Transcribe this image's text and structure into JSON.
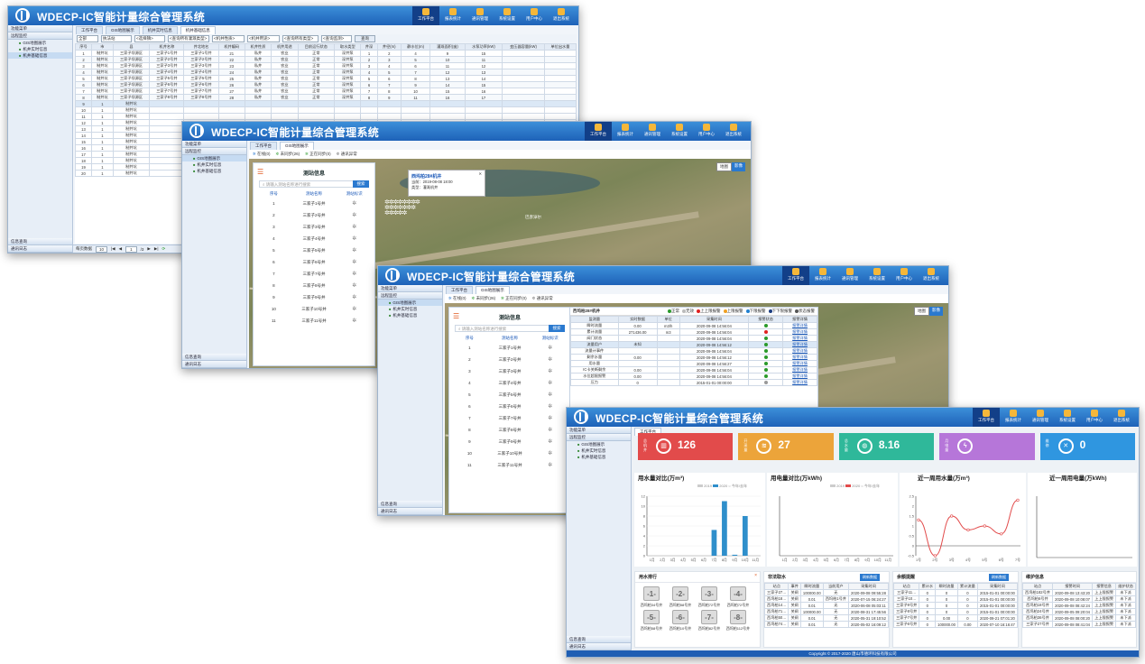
{
  "app": {
    "title": "WDECP-IC智能计量综合管理系统"
  },
  "nav": [
    "工作平台",
    "报表统计",
    "通讯管理",
    "系统设置",
    "用户中心",
    "退出系统"
  ],
  "sidebar": {
    "header": "功能菜单",
    "group": "远程监控",
    "items": [
      "GIS地图展示",
      "机井实时信息",
      "机井基础信息"
    ],
    "bottom": [
      "信息查询",
      "通讯日志"
    ]
  },
  "win1": {
    "tabs": [
      "工作平台",
      "GIS地图展示",
      "机井实时信息",
      "机井基础信息"
    ],
    "filter": {
      "range": "全部",
      "sel1": "执法站",
      "sel2": "<选择镇>",
      "sel3": "<查询所有灌溉类型>",
      "sel4": "<机井性质>",
      "sel5": "<机井用途>",
      "sel6": "<查询所有类型>",
      "sel7": "<查询监测>",
      "btn": "查询"
    },
    "columns": [
      "序号",
      "市",
      "县",
      "机井名称",
      "井北地名",
      "机井编码",
      "机井性质",
      "机井用途",
      "目前运行状态",
      "取水类型",
      "井深",
      "井径(m)",
      "静水位(m)",
      "灌溉面积(亩)",
      "水泵功率(kW)",
      "变压器容量(kW)",
      "单位出水量"
    ],
    "rows": [
      [
        "1",
        "制井坑",
        "三家子坝源区",
        "三家子1号井",
        "三家子1号井",
        "21",
        "私井",
        "农业",
        "正常",
        "深井泵",
        "1",
        "2",
        "4",
        "9",
        "15"
      ],
      [
        "2",
        "制井坑",
        "三家子坝源区",
        "三家子2号井",
        "三家子2号井",
        "22",
        "私井",
        "农业",
        "正常",
        "深井泵",
        "2",
        "3",
        "5",
        "10",
        "11"
      ],
      [
        "3",
        "制井坑",
        "三家子坝源区",
        "三家子3号井",
        "三家子3号井",
        "23",
        "私井",
        "农业",
        "正常",
        "深井泵",
        "3",
        "4",
        "6",
        "11",
        "12"
      ],
      [
        "4",
        "制井坑",
        "三家子坝源区",
        "三家子4号井",
        "三家子4号井",
        "24",
        "私井",
        "农业",
        "正常",
        "深井泵",
        "4",
        "5",
        "7",
        "12",
        "13"
      ],
      [
        "5",
        "制井坑",
        "三家子坝源区",
        "三家子5号井",
        "三家子5号井",
        "25",
        "私井",
        "农业",
        "正常",
        "深井泵",
        "5",
        "6",
        "8",
        "13",
        "14"
      ],
      [
        "6",
        "制井坑",
        "三家子坝源区",
        "三家子6号井",
        "三家子6号井",
        "26",
        "私井",
        "农业",
        "正常",
        "深井泵",
        "6",
        "7",
        "9",
        "14",
        "15"
      ],
      [
        "7",
        "制井坑",
        "三家子坝源区",
        "三家子7号井",
        "三家子7号井",
        "27",
        "私井",
        "农业",
        "正常",
        "深井泵",
        "7",
        "8",
        "10",
        "15",
        "16"
      ],
      [
        "8",
        "制井坑",
        "三家子坝源区",
        "三家子8号井",
        "三家子8号井",
        "28",
        "私井",
        "农业",
        "正常",
        "深井泵",
        "8",
        "9",
        "11",
        "16",
        "17"
      ]
    ],
    "rownums": [
      "9",
      "10",
      "11",
      "12",
      "13",
      "14",
      "15",
      "16",
      "17",
      "18",
      "19",
      "20"
    ],
    "pager": {
      "size": "每页数据",
      "num": "10",
      "page": "1",
      "of": "/3"
    }
  },
  "win2": {
    "tabs": [
      "工作平台",
      "GIS地图展示"
    ],
    "legend": [
      "在线(0)",
      "未同步(26)",
      "正在同步(0)",
      "通讯异常"
    ],
    "panel_title": "测站信息",
    "search_ph": "请输入测站名称进行搜索",
    "search_btn": "搜索",
    "cols": [
      "序号",
      "测站名称",
      "测站标识"
    ],
    "stations": [
      "三家子1号井",
      "三家子2号井",
      "三家子3号井",
      "三家子4号井",
      "三家子5号井",
      "三家子6号井",
      "三家子7号井",
      "三家子8号井",
      "三家子9号井",
      "三家子10号井",
      "三家子11号井"
    ],
    "popup": {
      "title": "西坞柏28#机井",
      "line1": "当前：",
      "line2": "类型：",
      "val1": "2019-08-08 18:00",
      "val2": "灌溉机井"
    },
    "mapbtns": [
      "地图",
      "影像"
    ],
    "place": "巴彦淖尔"
  },
  "win3": {
    "tabs": [
      "工作平台",
      "GIS地图展示"
    ],
    "legend": [
      "在线(0)",
      "未同步(26)",
      "正在同步(0)",
      "通讯异常"
    ],
    "panel_title": "测站信息",
    "stations": [
      "三家子1号井",
      "三家子2号井",
      "三家子3号井",
      "三家子4号井",
      "三家子5号井",
      "三家子6号井",
      "三家子7号井",
      "三家子8号井",
      "三家子9号井",
      "三家子10号井",
      "三家子11号井"
    ],
    "detail_title": "西坞柏28#机井",
    "status_legend": [
      "正常",
      "无效",
      "上上限报警",
      "上限报警",
      "下限报警",
      "下下限报警",
      "状态报警"
    ],
    "detail_cols": [
      "监测量",
      "实时数据",
      "单位",
      "采集时间",
      "报警状态",
      "报警详情"
    ],
    "detail_rows": [
      [
        "瞬时流量",
        "0.00",
        "m3/h",
        "2020-09-08 14:56:04",
        "green",
        "报警详情"
      ],
      [
        "累计流量",
        "271436.00",
        "m3",
        "2020-09-08 14:56:04",
        "red",
        "报警详情"
      ],
      [
        "阀门状态",
        "",
        "",
        "2020-09-08 14:56:04",
        "green",
        "报警详情"
      ],
      [
        "流量用户",
        "未知",
        "",
        "2020-09-08 14:56:12",
        "green",
        "报警详情"
      ],
      [
        "流量计事件",
        "",
        "",
        "2020-09-08 14:56:04",
        "green",
        "报警详情"
      ],
      [
        "剩余水量",
        "0.00",
        "",
        "2020-09-08 14:56:12",
        "green",
        "报警详情"
      ],
      [
        "用水量",
        "",
        "",
        "2020-09-08 14:56:27",
        "green",
        "报警详情"
      ],
      [
        "IC卡关断剩余",
        "0.00",
        "",
        "2020-09-08 14:56:04",
        "green",
        "报警详情"
      ],
      [
        "水位超限报警",
        "0.00",
        "",
        "2020-09-08 14:56:04",
        "green",
        "报警详情"
      ],
      [
        "压力",
        "0",
        "",
        "2015-01-01 00:00:00",
        "gray",
        "报警详情"
      ]
    ]
  },
  "win4": {
    "cards": [
      {
        "label": "总机井",
        "value": "126",
        "color": "#e24b4b"
      },
      {
        "label": "开采量",
        "value": "27",
        "color": "#eca43a"
      },
      {
        "label": "总水量",
        "value": "8.16",
        "color": "#2fb89a"
      },
      {
        "label": "月电量",
        "value": "",
        "color": "#b676d9"
      },
      {
        "label": "维修",
        "value": "0",
        "color": "#2f96e0"
      }
    ],
    "charts": [
      {
        "title": "用水量对比(万m³)",
        "legend": [
          "2019",
          "2020",
          "今年/去年"
        ]
      },
      {
        "title": "用电量对比(万kWh)",
        "legend": [
          "2019",
          "2020",
          "今年/去年"
        ]
      },
      {
        "title": "近一周用水量(万m³)"
      },
      {
        "title": "近一周用电量(万kWh)"
      }
    ],
    "rank": {
      "title": "用水排行",
      "items": [
        {
          "rank": "-1-",
          "name": "西坞柏34号井"
        },
        {
          "rank": "-2-",
          "name": "西坞柏58号井"
        },
        {
          "rank": "-3-",
          "name": "西坞柏72号井"
        },
        {
          "rank": "-4-",
          "name": "西坞柏72号井"
        },
        {
          "rank": "-5-",
          "name": "西坞柏58号井"
        },
        {
          "rank": "-6-",
          "name": "西坞柏10号井"
        },
        {
          "rank": "-7-",
          "name": "西坞柏82号井"
        },
        {
          "rank": "-8-",
          "name": "西坞柏112号井"
        }
      ]
    },
    "illegal": {
      "title": "非法取水",
      "btn": "刷新数据",
      "cols": [
        "站点",
        "事件",
        "瞬时流量",
        "当前用户",
        "采集时间"
      ],
      "rows": [
        [
          "三家子27…",
          "关闸",
          "100000.00",
          "无",
          "2020-09-08 09:55:28"
        ],
        [
          "西坞柏18…",
          "关闸",
          "0.01",
          "西坞柏1号井",
          "2020-07-15 06:24:27"
        ],
        [
          "西坞柏14…",
          "关闸",
          "0.01",
          "无",
          "2020-06-08 05:03:11"
        ],
        [
          "西坞柏71…",
          "关闸",
          "100000.00",
          "无",
          "2020-08-31 17:45:56"
        ],
        [
          "西坞柏50…",
          "关闸",
          "0.01",
          "无",
          "2020-05-31 19:10:52"
        ],
        [
          "西坞柏74…",
          "关闸",
          "0.01",
          "无",
          "2020-05-02 16:09:12"
        ]
      ]
    },
    "pressure": {
      "title": "余额提醒",
      "btn": "刷新数据",
      "cols": [
        "站点",
        "累计水",
        "瞬时流量",
        "累计流量",
        "采集时间"
      ],
      "rows": [
        [
          "三家子11…",
          "0",
          "0",
          "0",
          "2015-01-01 00:00:00"
        ],
        [
          "三家子10…",
          "0",
          "0",
          "0",
          "2015-01-01 00:00:00"
        ],
        [
          "三家子9号井",
          "0",
          "0",
          "0",
          "2015-01-01 00:00:00"
        ],
        [
          "三家子8号井",
          "0",
          "0",
          "0",
          "2015-01-01 00:00:00"
        ],
        [
          "三家子7号井",
          "0",
          "0.00",
          "0",
          "2020-09-21 07:01:20"
        ],
        [
          "三家子6号井",
          "0",
          "100000.00",
          "0.00",
          "2020-07-10 16:16:47"
        ]
      ]
    },
    "maint": {
      "title": "维护信息",
      "cols": [
        "站点",
        "报警时间",
        "报警信息",
        "维护状态"
      ],
      "rows": [
        [
          "西坞柏182号井",
          "2020-09-08 13:43:20",
          "上上限报警",
          "未下派"
        ],
        [
          "西坞柏6号井",
          "2020-09-08 10:08:07",
          "上上限报警",
          "未下派"
        ],
        [
          "西坞柏18号井",
          "2020-09-08 08:42:24",
          "上上限报警",
          "未下派"
        ],
        [
          "西坞柏24号井",
          "2020-09-05 09:20:04",
          "上上限报警",
          "未下派"
        ],
        [
          "西坞柏36号井",
          "2020-09-08 08:00:20",
          "上上限报警",
          "未下派"
        ],
        [
          "三家子27号井",
          "2020-09-08 08:41:04",
          "上上限报警",
          "未下派"
        ]
      ]
    },
    "copyright": "Copyright © 2017-2020 唐山市德环科技有限公司"
  },
  "chart_data": [
    {
      "type": "bar",
      "title": "用水量对比(万m³)",
      "categories": [
        "1月",
        "2月",
        "3月",
        "4月",
        "5月",
        "6月",
        "7月",
        "8月",
        "9月",
        "10月",
        "11月"
      ],
      "series": [
        {
          "name": "2019",
          "values": [
            0,
            0,
            0,
            0,
            0,
            0,
            0,
            0,
            0,
            0,
            0
          ]
        },
        {
          "name": "2020",
          "values": [
            0,
            0,
            0,
            0,
            0,
            0,
            5.2,
            11,
            0.2,
            8,
            0
          ]
        }
      ],
      "ylim": [
        0,
        12
      ]
    },
    {
      "type": "bar",
      "title": "用电量对比(万kWh)",
      "categories": [
        "1月",
        "2月",
        "3月",
        "4月",
        "5月",
        "6月",
        "7月",
        "8月",
        "9月",
        "10月",
        "11月"
      ],
      "series": [
        {
          "name": "2019",
          "values": [
            0,
            0,
            0,
            0,
            0,
            0,
            0,
            0,
            0,
            0,
            0
          ]
        },
        {
          "name": "2020",
          "values": [
            0,
            0,
            0,
            0,
            0,
            0,
            0,
            0,
            0,
            0,
            0
          ]
        }
      ]
    },
    {
      "type": "line",
      "title": "近一周用水量(万m³)",
      "categories": [
        "1号",
        "2号",
        "3号",
        "4号",
        "5号",
        "6号",
        "7号"
      ],
      "series": [
        {
          "name": "",
          "values": [
            1.3,
            -0.5,
            1.5,
            0.8,
            1.0,
            0.6,
            2.3
          ]
        }
      ],
      "ylim": [
        -0.5,
        2.5
      ]
    },
    {
      "type": "line",
      "title": "近一周用电量(万kWh)",
      "categories": [],
      "series": []
    }
  ]
}
